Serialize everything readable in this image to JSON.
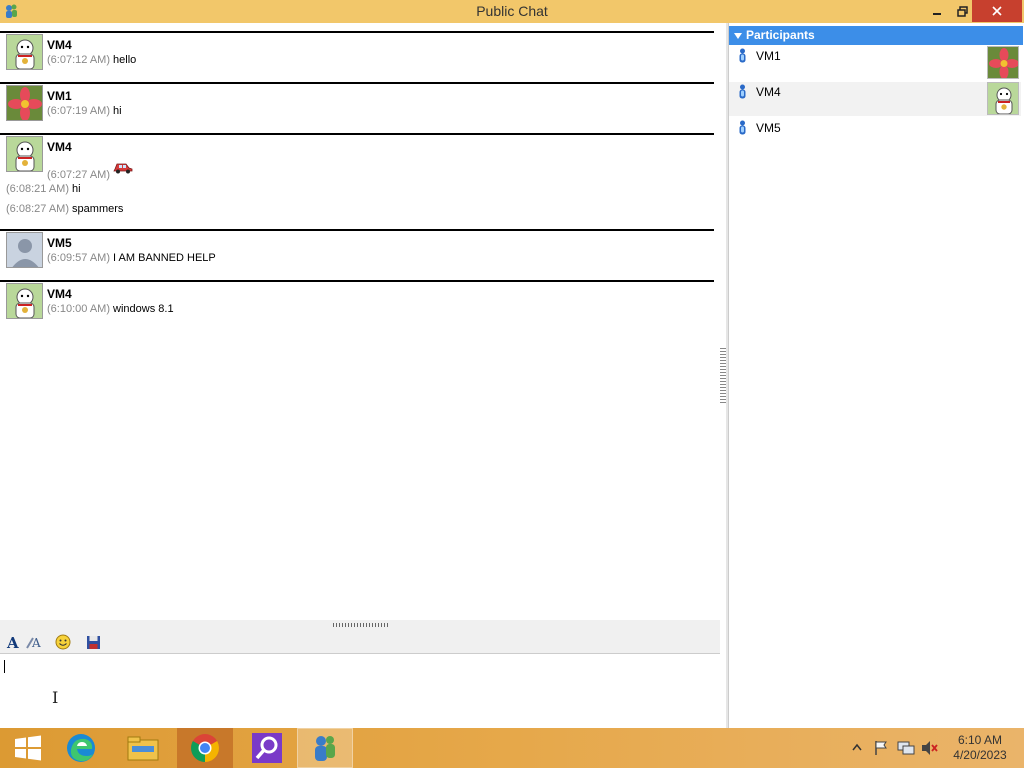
{
  "window": {
    "title": "Public Chat"
  },
  "messages": [
    {
      "sender": "VM4",
      "lines": [
        {
          "time": "(6:07:12 AM)",
          "text": "hello"
        }
      ]
    },
    {
      "sender": "VM1",
      "lines": [
        {
          "time": "(6:07:19 AM)",
          "text": "hi"
        }
      ]
    },
    {
      "sender": "VM4",
      "lines": [
        {
          "time": "(6:07:27 AM)",
          "text": ""
        },
        {
          "time": "(6:08:21 AM)",
          "text": "hi"
        },
        {
          "time": "(6:08:27 AM)",
          "text": "spammers"
        }
      ]
    },
    {
      "sender": "VM5",
      "lines": [
        {
          "time": "(6:09:57 AM)",
          "text": "I AM BANNED HELP"
        }
      ]
    },
    {
      "sender": "VM4",
      "lines": [
        {
          "time": "(6:10:00 AM)",
          "text": "windows 8.1"
        }
      ]
    }
  ],
  "participants": {
    "header": "Participants",
    "items": [
      {
        "name": "VM1"
      },
      {
        "name": "VM4"
      },
      {
        "name": "VM5"
      }
    ]
  },
  "taskbar": {
    "clock_time": "6:10 AM",
    "clock_date": "4/20/2023"
  },
  "colors": {
    "titlebar": "#f2c76a",
    "close": "#c7402e",
    "panel_header": "#3c8ee8",
    "taskbar": "#e6a84a",
    "timestamp": "#888888"
  },
  "icons": [
    "app-icon",
    "minimize-icon",
    "restore-icon",
    "close-icon",
    "font-icon",
    "font-color-icon",
    "smiley-icon",
    "save-icon",
    "car-emoticon-icon",
    "participant-icon",
    "windows-start-icon",
    "edge-icon",
    "file-explorer-icon",
    "chrome-icon",
    "search-app-icon",
    "chat-app-icon",
    "tray-overflow-icon",
    "action-center-icon",
    "network-icon",
    "volume-muted-icon"
  ]
}
